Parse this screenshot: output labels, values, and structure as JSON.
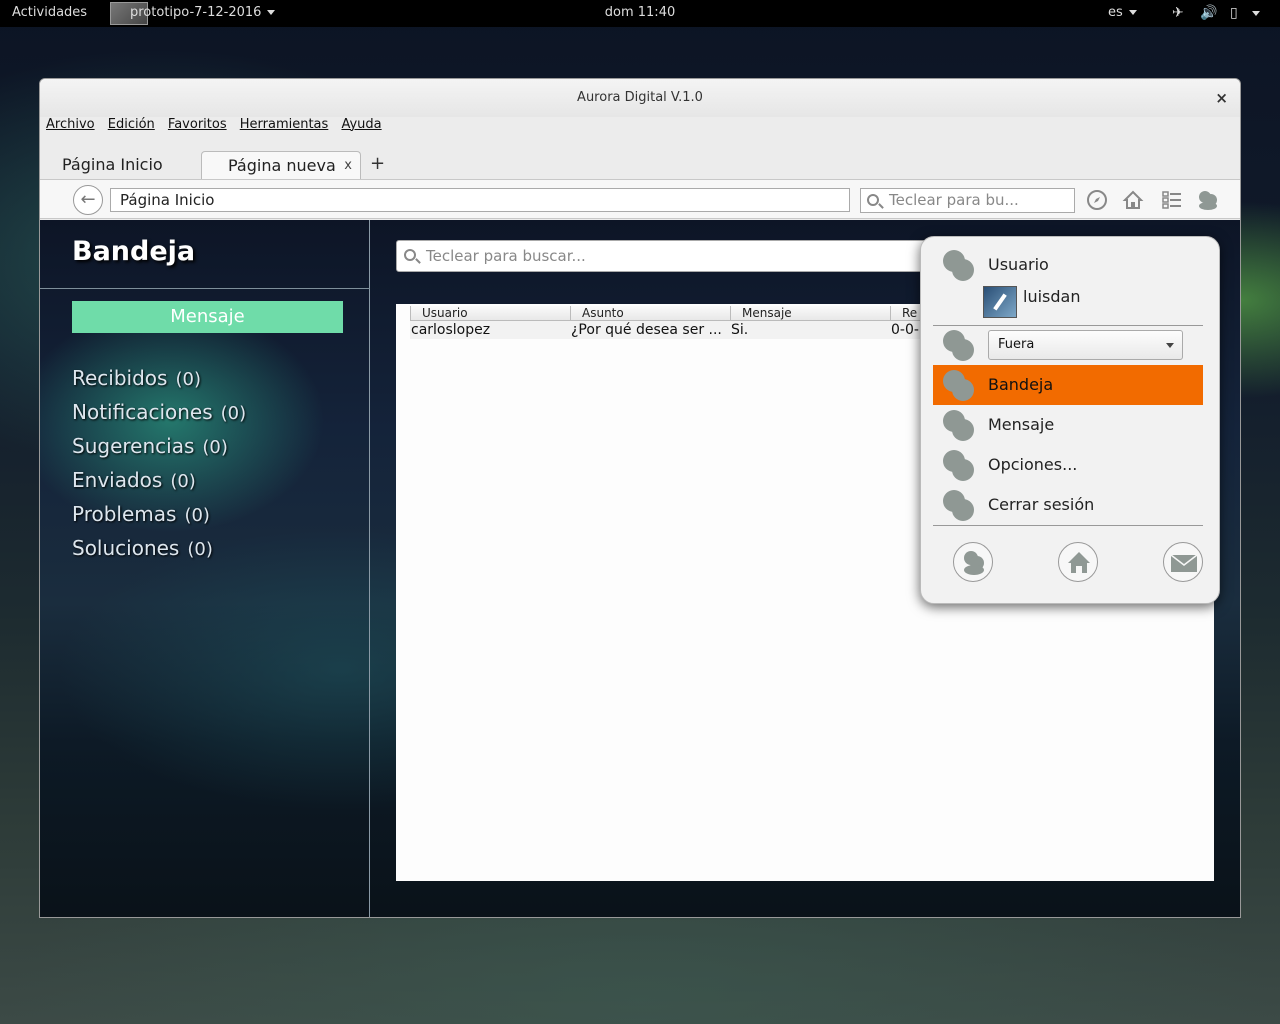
{
  "topbar": {
    "activities": "Actividades",
    "app_name": "prototipo-7-12-2016",
    "clock": "dom 11:40",
    "language": "es",
    "icons": [
      "airplane-icon",
      "volume-icon",
      "battery-icon",
      "power-menu-icon"
    ]
  },
  "window": {
    "title": "Aurora Digital V.1.0",
    "close_label": "×",
    "menu": [
      "Archivo",
      "Edición",
      "Favoritos",
      "Herramientas",
      "Ayuda"
    ],
    "tabs": [
      {
        "label": "Página Inicio",
        "close": "x"
      },
      {
        "label": "Página nueva",
        "close": "x"
      }
    ],
    "new_tab": "+",
    "toolbar": {
      "url": "Página Inicio",
      "search_placeholder": "Teclear para bu...",
      "icons": [
        "back-arrow-icon",
        "compass-icon",
        "home-icon",
        "list-icon",
        "user-icon"
      ]
    }
  },
  "sidebar": {
    "title": "Bandeja",
    "message_button": "Mensaje",
    "items": [
      {
        "label": "Recibidos",
        "count": "(0)"
      },
      {
        "label": "Notificaciones",
        "count": "(0)"
      },
      {
        "label": "Sugerencias",
        "count": "(0)"
      },
      {
        "label": "Enviados",
        "count": "(0)"
      },
      {
        "label": "Problemas",
        "count": "(0)"
      },
      {
        "label": "Soluciones",
        "count": "(0)"
      }
    ]
  },
  "main": {
    "search_placeholder": "Teclear para buscar...",
    "table": {
      "columns": [
        "Usuario",
        "Asunto",
        "Mensaje",
        "Re"
      ],
      "rows": [
        {
          "usuario": "carloslopez",
          "asunto": "¿Por qué desea ser ...",
          "mensaje": "Si.",
          "re": "0-0-"
        }
      ]
    }
  },
  "popover": {
    "user_header": "Usuario",
    "username": "luisdan",
    "status_value": "Fuera",
    "menu": [
      "Bandeja",
      "Mensaje",
      "Opciones...",
      "Cerrar sesión"
    ],
    "active_item": "Bandeja",
    "active_color": "#f26b00",
    "bottom_icons": [
      "user-icon",
      "home-icon",
      "mail-icon"
    ]
  },
  "colors": {
    "accent_button": "#6fdca9",
    "highlight": "#f26b00"
  }
}
